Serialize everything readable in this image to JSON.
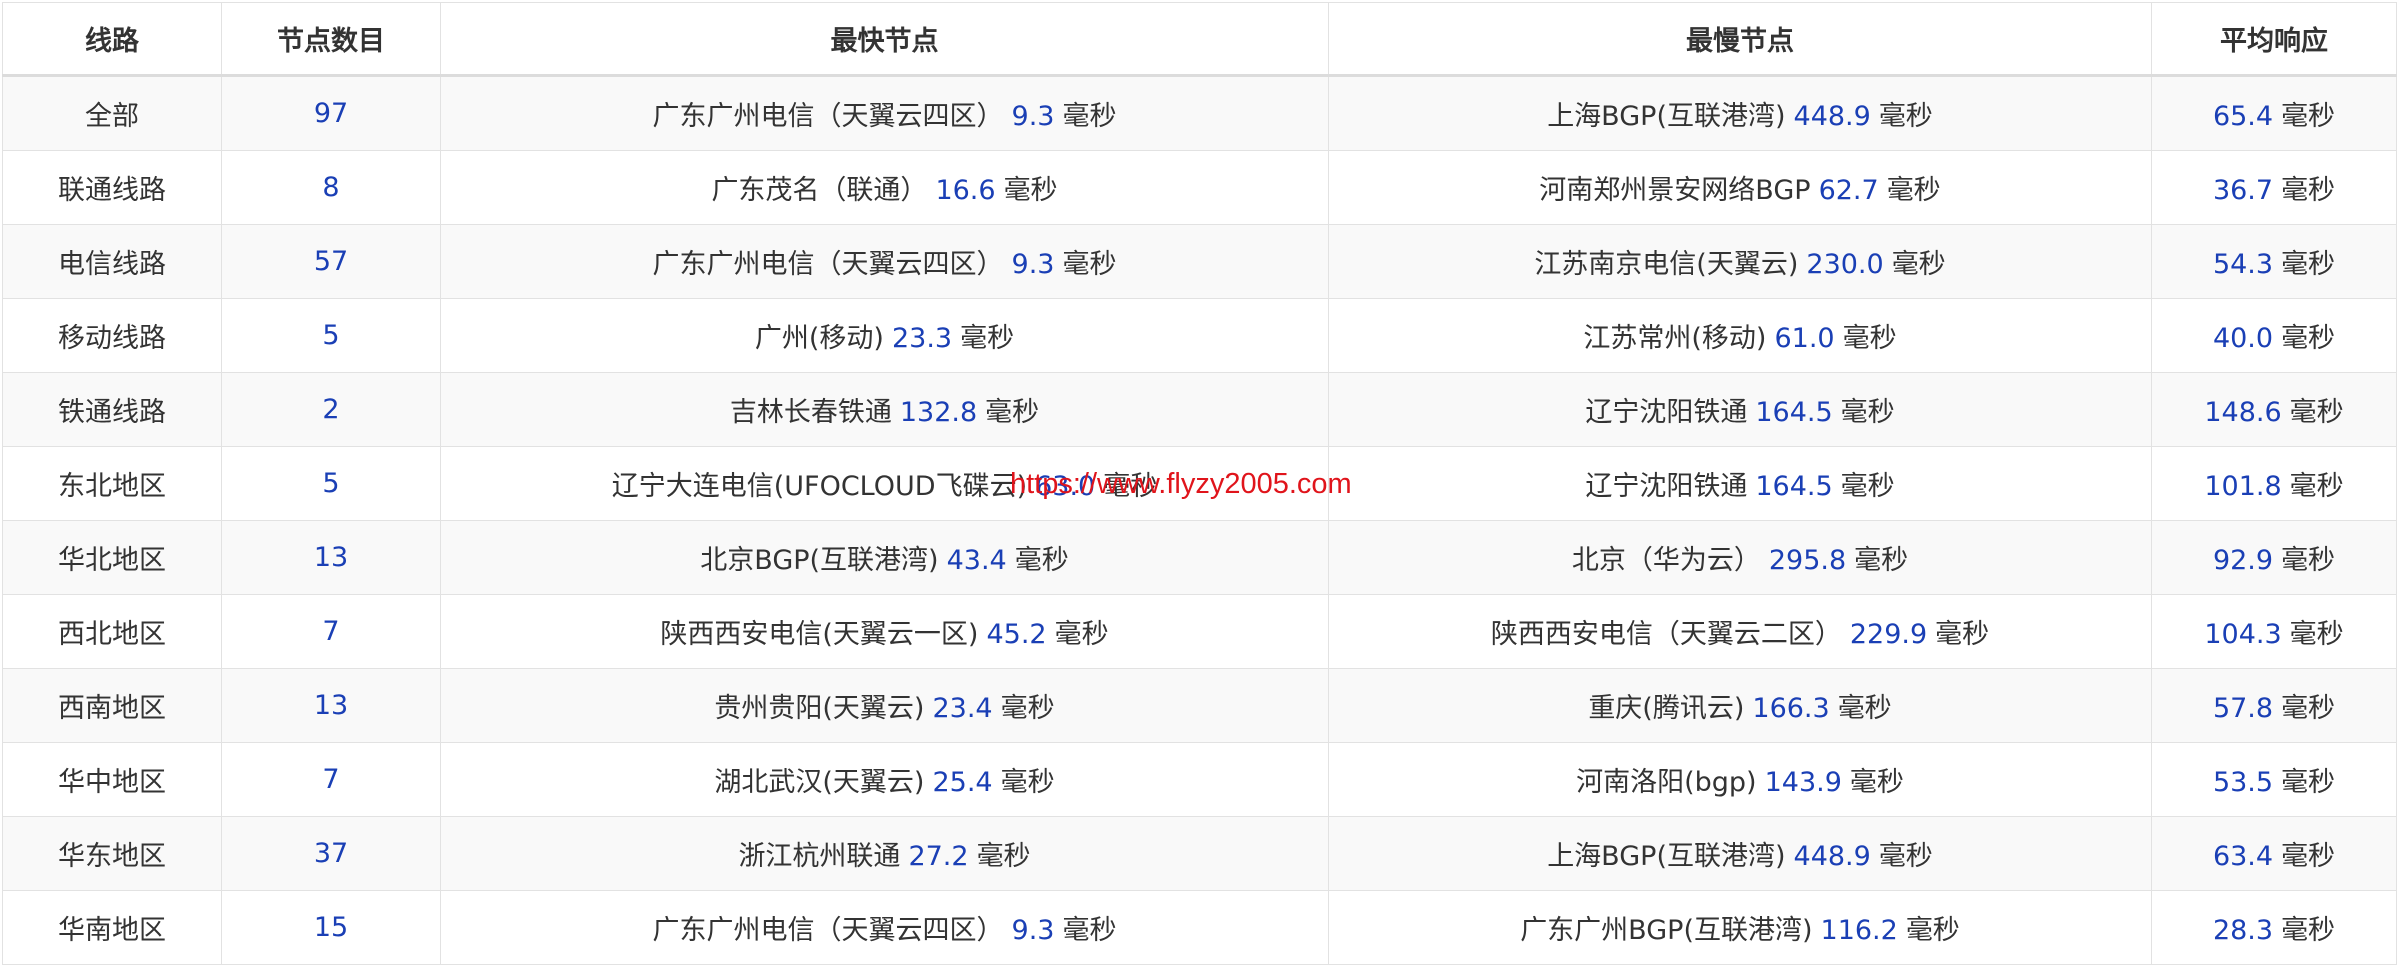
{
  "headers": [
    "线路",
    "节点数目",
    "最快节点",
    "最慢节点",
    "平均响应"
  ],
  "unit": "毫秒",
  "watermark": "https://www.flyzy2005.com",
  "rows": [
    {
      "line": "全部",
      "count": "97",
      "fastest_name": "广东广州电信（天翼云四区）",
      "fastest_ms": "9.3",
      "slowest_name": "上海BGP(互联港湾)",
      "slowest_ms": "448.9",
      "avg_ms": "65.4"
    },
    {
      "line": "联通线路",
      "count": "8",
      "fastest_name": "广东茂名（联通）",
      "fastest_ms": "16.6",
      "slowest_name": "河南郑州景安网络BGP",
      "slowest_ms": "62.7",
      "avg_ms": "36.7"
    },
    {
      "line": "电信线路",
      "count": "57",
      "fastest_name": "广东广州电信（天翼云四区）",
      "fastest_ms": "9.3",
      "slowest_name": "江苏南京电信(天翼云)",
      "slowest_ms": "230.0",
      "avg_ms": "54.3"
    },
    {
      "line": "移动线路",
      "count": "5",
      "fastest_name": "广州(移动)",
      "fastest_ms": "23.3",
      "slowest_name": "江苏常州(移动)",
      "slowest_ms": "61.0",
      "avg_ms": "40.0"
    },
    {
      "line": "铁通线路",
      "count": "2",
      "fastest_name": "吉林长春铁通",
      "fastest_ms": "132.8",
      "slowest_name": "辽宁沈阳铁通",
      "slowest_ms": "164.5",
      "avg_ms": "148.6"
    },
    {
      "line": "东北地区",
      "count": "5",
      "fastest_name": "辽宁大连电信(UFOCLOUD飞碟云)",
      "fastest_ms": "63.0",
      "slowest_name": "辽宁沈阳铁通",
      "slowest_ms": "164.5",
      "avg_ms": "101.8"
    },
    {
      "line": "华北地区",
      "count": "13",
      "fastest_name": "北京BGP(互联港湾)",
      "fastest_ms": "43.4",
      "slowest_name": "北京（华为云）",
      "slowest_ms": "295.8",
      "avg_ms": "92.9"
    },
    {
      "line": "西北地区",
      "count": "7",
      "fastest_name": "陕西西安电信(天翼云一区)",
      "fastest_ms": "45.2",
      "slowest_name": "陕西西安电信（天翼云二区）",
      "slowest_ms": "229.9",
      "avg_ms": "104.3"
    },
    {
      "line": "西南地区",
      "count": "13",
      "fastest_name": "贵州贵阳(天翼云)",
      "fastest_ms": "23.4",
      "slowest_name": "重庆(腾讯云)",
      "slowest_ms": "166.3",
      "avg_ms": "57.8"
    },
    {
      "line": "华中地区",
      "count": "7",
      "fastest_name": "湖北武汉(天翼云)",
      "fastest_ms": "25.4",
      "slowest_name": "河南洛阳(bgp)",
      "slowest_ms": "143.9",
      "avg_ms": "53.5"
    },
    {
      "line": "华东地区",
      "count": "37",
      "fastest_name": "浙江杭州联通",
      "fastest_ms": "27.2",
      "slowest_name": "上海BGP(互联港湾)",
      "slowest_ms": "448.9",
      "avg_ms": "63.4"
    },
    {
      "line": "华南地区",
      "count": "15",
      "fastest_name": "广东广州电信（天翼云四区）",
      "fastest_ms": "9.3",
      "slowest_name": "广东广州BGP(互联港湾)",
      "slowest_ms": "116.2",
      "avg_ms": "28.3"
    }
  ]
}
